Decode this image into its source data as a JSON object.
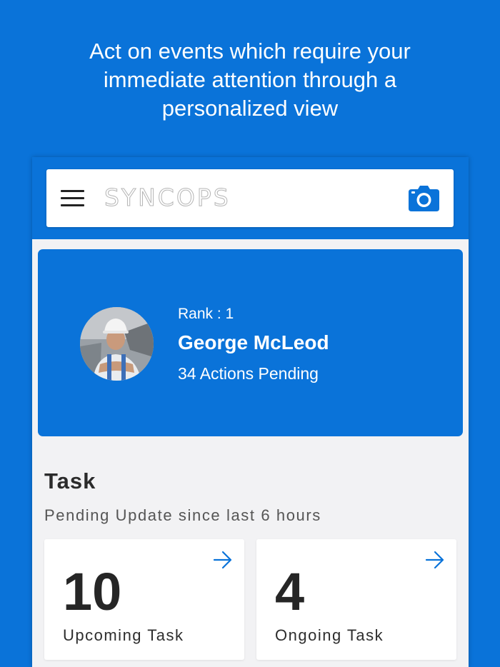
{
  "headline": "Act on events which require your immediate attention through a personalized view",
  "app": {
    "brand": "SYNCOPS",
    "icons": {
      "menu": "hamburger-menu-icon",
      "camera": "camera-icon"
    }
  },
  "profile": {
    "rank": "Rank : 1",
    "name": "George McLeod",
    "actions_pending": "34 Actions Pending"
  },
  "tasks": {
    "title": "Task",
    "subtitle": "Pending Update since last 6 hours",
    "cards": [
      {
        "count": "10",
        "label": "Upcoming Task"
      },
      {
        "count": "4",
        "label": "Ongoing Task"
      }
    ]
  },
  "colors": {
    "brand_blue": "#0a73d9",
    "background": "#f2f2f4",
    "card": "#ffffff"
  }
}
